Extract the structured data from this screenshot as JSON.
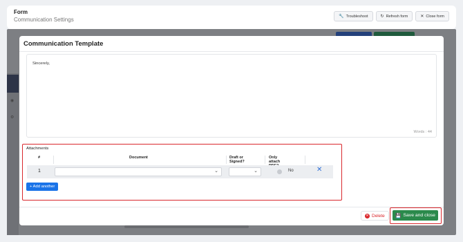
{
  "header": {
    "title": "Form",
    "subtitle": "Communication Settings",
    "actions": [
      {
        "label": "Troubleshoot",
        "icon": "wrench-icon"
      },
      {
        "label": "Refresh form",
        "icon": "refresh-icon"
      },
      {
        "label": "Close form",
        "icon": "close-icon"
      }
    ]
  },
  "modal": {
    "title": "Communication Template",
    "editor_text": "Sincerely,",
    "word_count": "Words : 44",
    "attachments": {
      "title": "Attachments",
      "columns": [
        "#",
        "Document",
        "Draft or Signed?",
        "Only attach PDF?"
      ],
      "rows": [
        {
          "num": "1",
          "document": "",
          "draft_or_signed": "",
          "only_pdf": "No"
        }
      ],
      "add_label": "+ Add another"
    },
    "footer": {
      "delete_label": "Delete",
      "save_label": "Save and close"
    }
  },
  "colors": {
    "primary": "#1a73e8",
    "success": "#2b8a4c",
    "danger": "#d9262b",
    "overlay": "#7d7f83"
  }
}
